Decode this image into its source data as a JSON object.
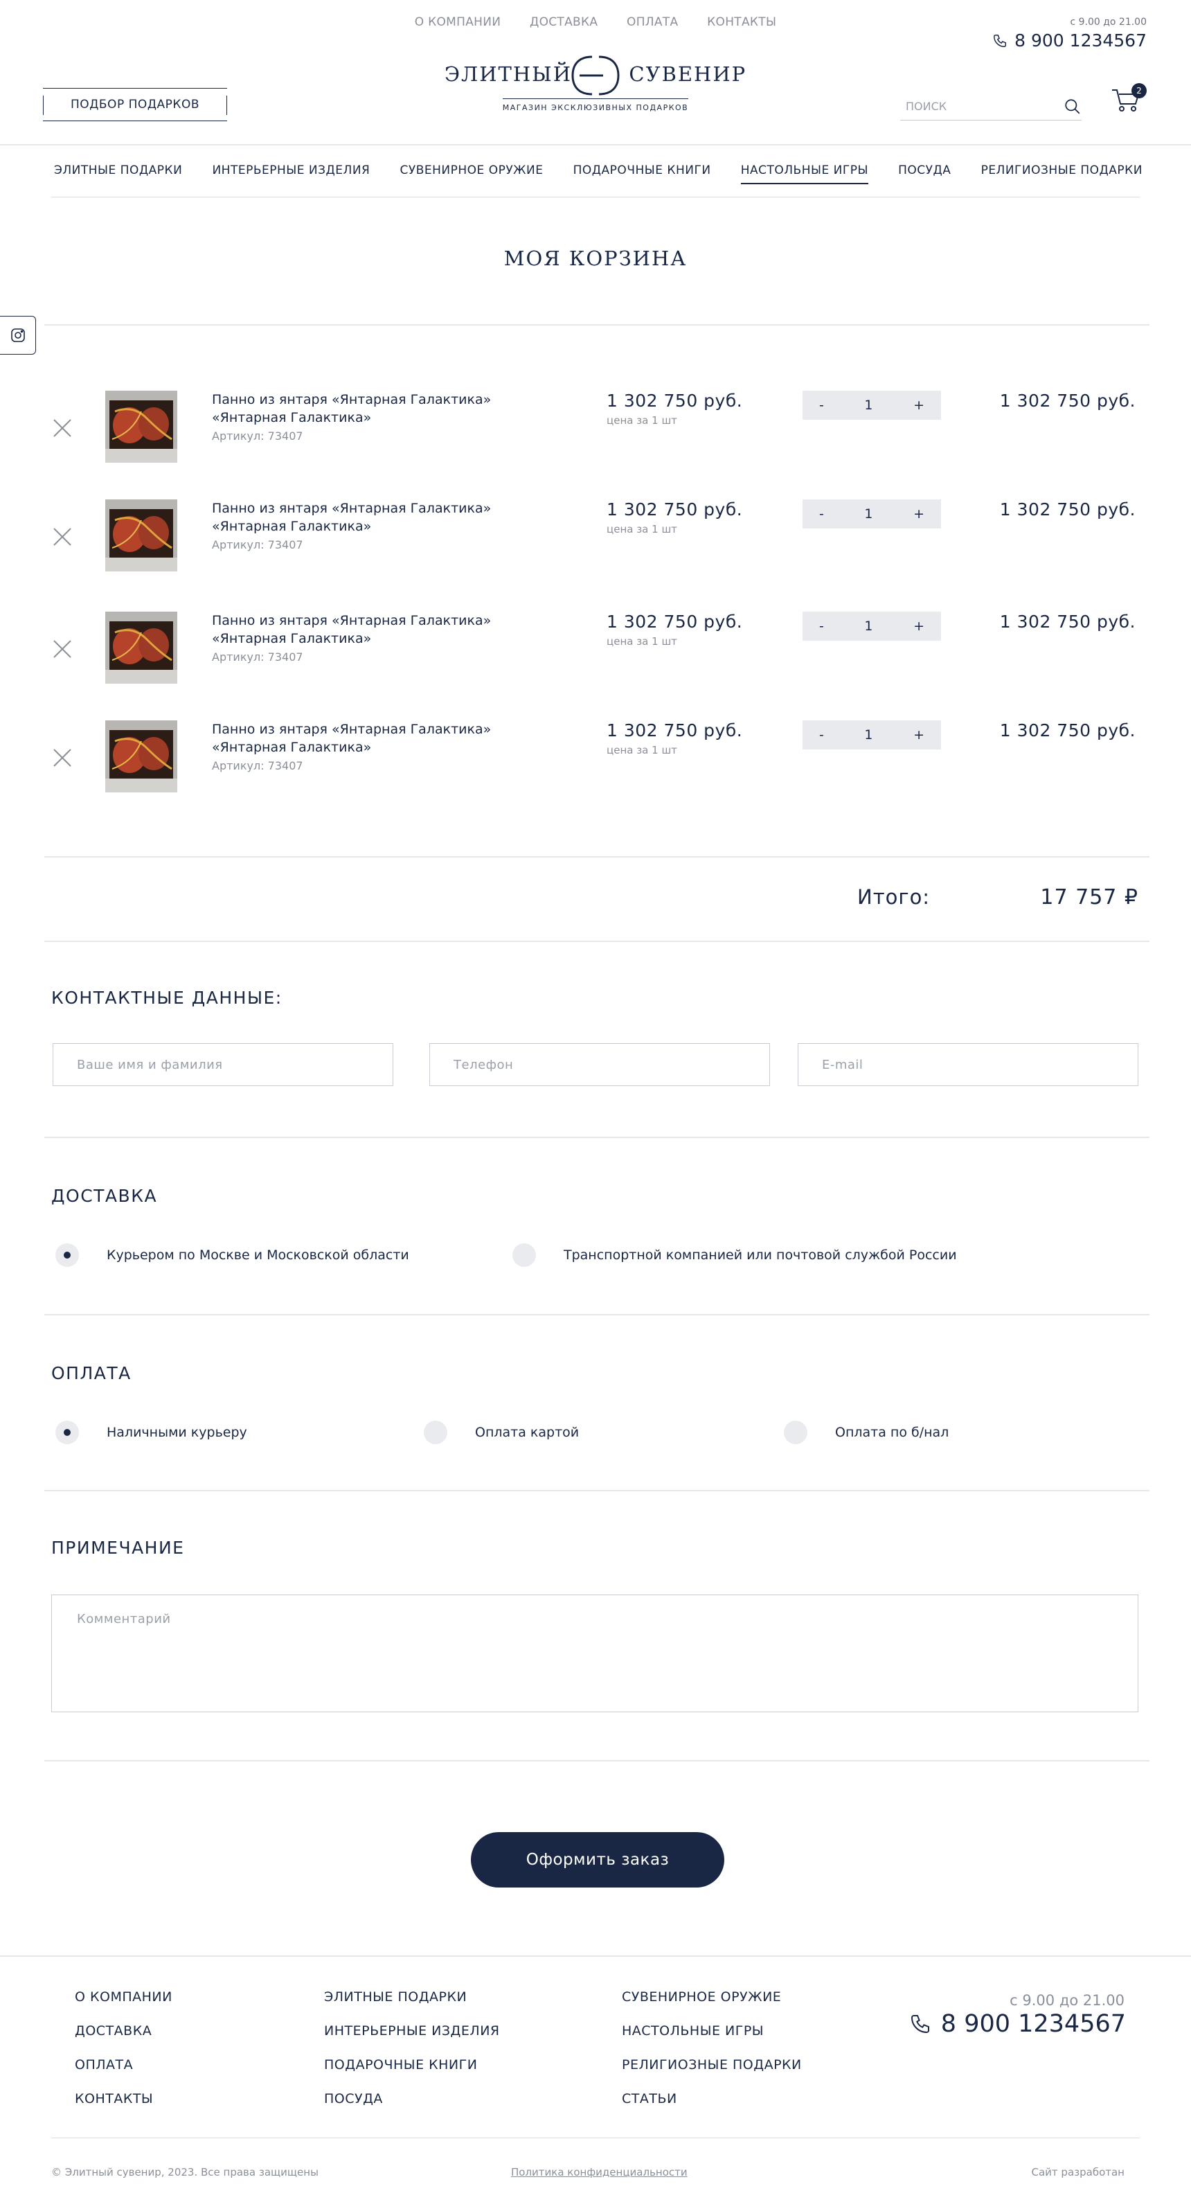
{
  "top_nav": [
    "О КОМПАНИИ",
    "ДОСТАВКА",
    "ОПЛАТА",
    "КОНТАКТЫ"
  ],
  "header": {
    "hours": "с 9.00 до 21.00",
    "phone": "8 900 1234567",
    "logo_name_left": "ЭЛИТНЫЙ",
    "logo_name_right": "СУВЕНИР",
    "logo_tagline": "МАГАЗИН ЭКСКЛЮЗИВНЫХ ПОДАРКОВ",
    "gift_button": "ПОДБОР ПОДАРКОВ",
    "search_placeholder": "ПОИСК",
    "cart_count": "2"
  },
  "categories": [
    {
      "label": "ЭЛИТНЫЕ ПОДАРКИ",
      "active": false
    },
    {
      "label": "ИНТЕРЬЕРНЫЕ ИЗДЕЛИЯ",
      "active": false
    },
    {
      "label": "СУВЕНИРНОЕ ОРУЖИЕ",
      "active": false
    },
    {
      "label": "ПОДАРОЧНЫЕ КНИГИ",
      "active": false
    },
    {
      "label": "НАСТОЛЬНЫЕ ИГРЫ",
      "active": true
    },
    {
      "label": "ПОСУДА",
      "active": false
    },
    {
      "label": "РЕЛИГИОЗНЫЕ ПОДАРКИ",
      "active": false
    }
  ],
  "page_title": "МОЯ КОРЗИНА",
  "cart_items": [
    {
      "name_line1": "Панно из янтаря «Янтарная Галактика»",
      "name_line2": "«Янтарная Галактика»",
      "sku": "Артикул: 73407",
      "price": "1 302 750 руб.",
      "unit": "цена за 1 шт",
      "qty": "1",
      "total": "1 302 750 руб."
    },
    {
      "name_line1": "Панно из янтаря «Янтарная Галактика»",
      "name_line2": "«Янтарная Галактика»",
      "sku": "Артикул: 73407",
      "price": "1 302 750 руб.",
      "unit": "цена за 1 шт",
      "qty": "1",
      "total": "1 302 750 руб."
    },
    {
      "name_line1": "Панно из янтаря «Янтарная Галактика»",
      "name_line2": "«Янтарная Галактика»",
      "sku": "Артикул: 73407",
      "price": "1 302 750 руб.",
      "unit": "цена за 1 шт",
      "qty": "1",
      "total": "1 302 750 руб."
    },
    {
      "name_line1": "Панно из янтаря «Янтарная Галактика»",
      "name_line2": "«Янтарная Галактика»",
      "sku": "Артикул: 73407",
      "price": "1 302 750 руб.",
      "unit": "цена за 1 шт",
      "qty": "1",
      "total": "1 302 750 руб."
    }
  ],
  "qty_minus": "-",
  "qty_plus": "+",
  "summary": {
    "label": "Итого:",
    "value": "17 757 ₽"
  },
  "contacts": {
    "title": "КОНТАКТНЫЕ ДАННЫЕ:",
    "name_placeholder": "Ваше имя и фамилия",
    "phone_placeholder": "Телефон",
    "email_placeholder": "E-mail"
  },
  "delivery": {
    "title": "ДОСТАВКА",
    "options": [
      {
        "label": "Курьером по Москве и Московской области",
        "selected": true
      },
      {
        "label": "Транспортной компанией или почтовой службой России",
        "selected": false
      }
    ]
  },
  "payment": {
    "title": "ОПЛАТА",
    "options": [
      {
        "label": "Наличными курьеру",
        "selected": true
      },
      {
        "label": "Оплата картой",
        "selected": false
      },
      {
        "label": "Оплата по б/нал",
        "selected": false
      }
    ]
  },
  "note": {
    "title": "ПРИМЕЧАНИЕ",
    "placeholder": "Комментарий"
  },
  "order_button": "Оформить заказ",
  "footer": {
    "col1": [
      "О КОМПАНИИ",
      "ДОСТАВКА",
      "ОПЛАТА",
      "КОНТАКТЫ"
    ],
    "col2": [
      "ЭЛИТНЫЕ ПОДАРКИ",
      "ИНТЕРЬЕРНЫЕ ИЗДЕЛИЯ",
      "ПОДАРОЧНЫЕ КНИГИ",
      "ПОСУДА"
    ],
    "col3": [
      "СУВЕНИРНОЕ ОРУЖИЕ",
      "НАСТОЛЬНЫЕ ИГРЫ",
      "РЕЛИГИОЗНЫЕ ПОДАРКИ",
      "СТАТЬИ"
    ],
    "hours": "с 9.00 до 21.00",
    "phone": "8 900 1234567",
    "copyright": "© Элитный сувенир, 2023. Все права защищены",
    "privacy": "Политика конфиденциальности",
    "developer": "Сайт разработан"
  },
  "colors": {
    "brand": "#1a2744",
    "muted": "#8a8f99",
    "qty_bg": "#e9eaee"
  }
}
